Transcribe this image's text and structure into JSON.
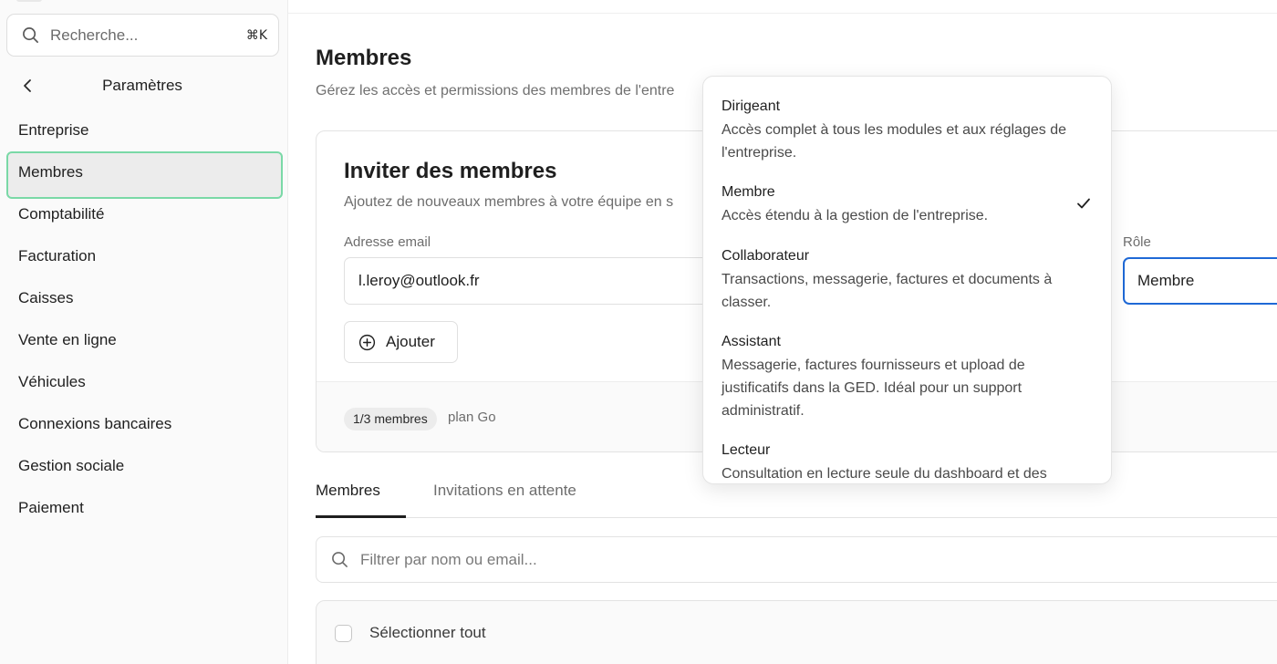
{
  "sidebar": {
    "search": {
      "placeholder": "Recherche...",
      "shortcut": "⌘K"
    },
    "section_title": "Paramètres",
    "items": [
      {
        "label": "Entreprise"
      },
      {
        "label": "Membres"
      },
      {
        "label": "Comptabilité"
      },
      {
        "label": "Facturation"
      },
      {
        "label": "Caisses"
      },
      {
        "label": "Vente en ligne"
      },
      {
        "label": "Véhicules"
      },
      {
        "label": "Connexions bancaires"
      },
      {
        "label": "Gestion sociale"
      },
      {
        "label": "Paiement"
      }
    ],
    "active_item": "Membres"
  },
  "page": {
    "title": "Membres",
    "subtitle": "Gérez les accès et permissions des membres de l'entre"
  },
  "invite": {
    "title": "Inviter des membres",
    "subtitle": "Ajoutez de nouveaux membres à votre équipe en s",
    "email_label": "Adresse email",
    "email_value": "l.leroy@outlook.fr",
    "role_label": "Rôle",
    "role_value": "Membre",
    "add_label": "Ajouter",
    "count_badge": "1/3 membres",
    "plan": "plan Go"
  },
  "tabs": [
    {
      "label": "Membres"
    },
    {
      "label": "Invitations en attente"
    }
  ],
  "filter": {
    "placeholder": "Filtrer par nom ou email..."
  },
  "list": {
    "select_all": "Sélectionner tout"
  },
  "role_dropdown": {
    "selected": "Membre",
    "options": [
      {
        "name": "Dirigeant",
        "desc": "Accès complet à tous les modules et aux réglages de l'entreprise."
      },
      {
        "name": "Membre",
        "desc": "Accès étendu à la gestion de l'entreprise."
      },
      {
        "name": "Collaborateur",
        "desc": "Transactions, messagerie, factures et documents à classer."
      },
      {
        "name": "Assistant",
        "desc": "Messagerie, factures fournisseurs et upload de justificatifs dans la GED. Idéal pour un support administratif."
      },
      {
        "name": "Lecteur",
        "desc": "Consultation en lecture seule du dashboard et des"
      }
    ]
  },
  "colors": {
    "active_nav_border": "#7ad9a7",
    "focus_border": "#1f69d6"
  }
}
